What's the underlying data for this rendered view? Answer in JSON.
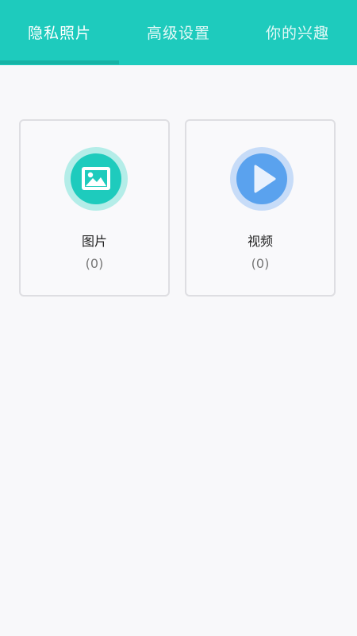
{
  "tabs": [
    {
      "label": "隐私照片",
      "selected": true
    },
    {
      "label": "高级设置",
      "selected": false
    },
    {
      "label": "你的兴趣",
      "selected": false
    }
  ],
  "colors": {
    "accent": "#1ecbbd",
    "indicator": "#17b3a5",
    "picture_icon": "#1ecbbd",
    "video_icon": "#5aa2ee",
    "background": "#f8f8fa"
  },
  "cards": {
    "pictures": {
      "title": "图片",
      "count": "(0)",
      "icon": "image-icon"
    },
    "videos": {
      "title": "视频",
      "count": "(0)",
      "icon": "play-icon"
    }
  }
}
